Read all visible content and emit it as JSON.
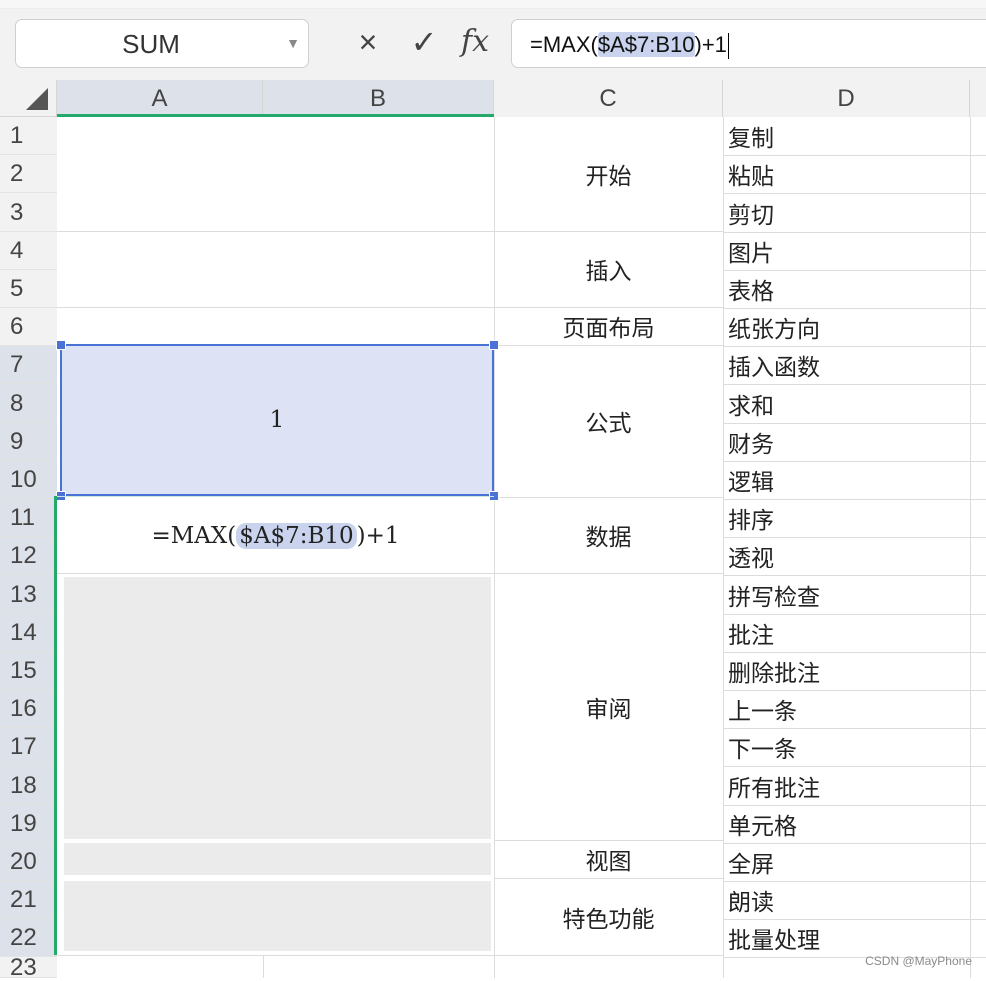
{
  "name_box": {
    "value": "SUM"
  },
  "formula_bar": {
    "cancel_glyph": "×",
    "confirm_glyph": "✓",
    "fx_label": "fx",
    "text_before": "=MAX(",
    "text_ref": "$A$7:B10",
    "text_after": ")+1"
  },
  "columns": [
    "A",
    "B",
    "C",
    "D"
  ],
  "rows": [
    "1",
    "2",
    "3",
    "4",
    "5",
    "6",
    "7",
    "8",
    "9",
    "10",
    "11",
    "12",
    "13",
    "14",
    "15",
    "16",
    "17",
    "18",
    "19",
    "20",
    "21",
    "22",
    "23"
  ],
  "cells": {
    "a7_value": "1",
    "a11_before": "=MAX(",
    "a11_ref": "$A$7:B10",
    "a11_after": ")+1"
  },
  "column_c": [
    "开始",
    "插入",
    "页面布局",
    "公式",
    "数据",
    "审阅",
    "视图",
    "特色功能"
  ],
  "column_d": [
    "复制",
    "粘贴",
    "剪切",
    "图片",
    "表格",
    "纸张方向",
    "插入函数",
    "求和",
    "财务",
    "逻辑",
    "排序",
    "透视",
    "拼写检查",
    "批注",
    "删除批注",
    "上一条",
    "下一条",
    "所有批注",
    "单元格",
    "全屏",
    "朗读",
    "批量处理"
  ],
  "watermark": "CSDN @MayPhone",
  "colors": {
    "accent_green": "#23a96a",
    "selection_blue": "#4a72d4",
    "selection_fill": "#dde3f4",
    "ref_highlight": "#c9d3ee"
  }
}
